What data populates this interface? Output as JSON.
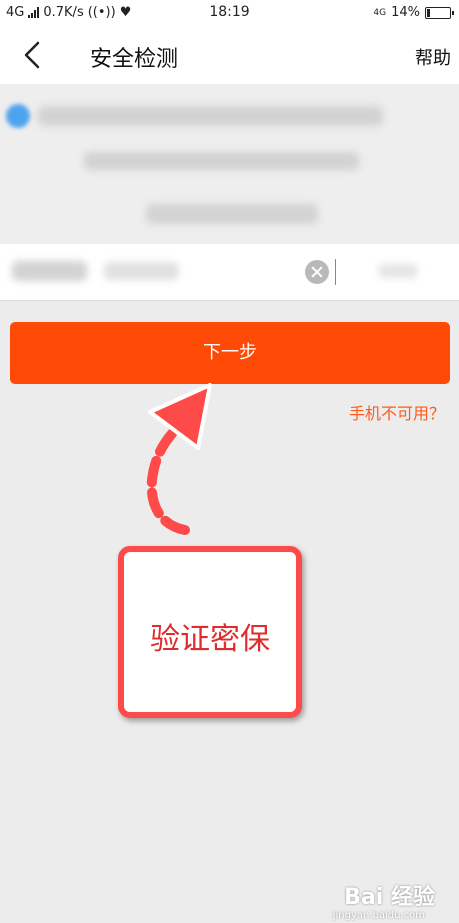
{
  "status_bar": {
    "network": "4G",
    "speed": "0.7K/s",
    "time": "18:19",
    "network_right": "4G",
    "battery": "14%",
    "battery_level": 0.14
  },
  "nav": {
    "title": "安全检测",
    "help": "帮助",
    "back_icon": "chevron-left-icon"
  },
  "actions": {
    "next_button": "下一步",
    "phone_unavailable": "手机不可用？"
  },
  "annotation": {
    "text": "验证密保",
    "color": "#ff4a4a"
  },
  "watermark": {
    "text": "Bai 经验",
    "sub": "jingyan.baidu.com"
  },
  "colors": {
    "accent": "#ff4a06",
    "link": "#ff5a1a",
    "background": "#ececec"
  }
}
